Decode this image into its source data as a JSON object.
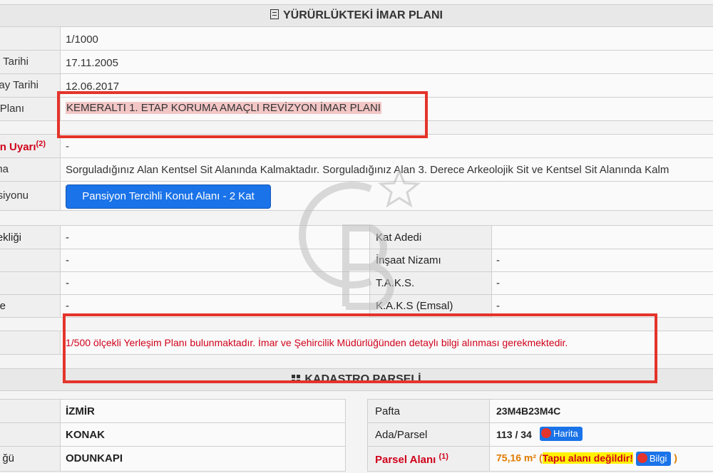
{
  "section_imar": {
    "title": "YÜRÜRLÜKTEKİ İMAR PLANI",
    "icon": "document-icon"
  },
  "rows": [
    {
      "label": "",
      "value": "1/1000"
    },
    {
      "label": "Tarihi",
      "value": "17.11.2005"
    },
    {
      "label": "ay Tarihi",
      "value": "12.06.2017"
    },
    {
      "label": "Planı",
      "value": "KEMERALTI 1. ETAP KORUMA AMAÇLI REVİZYON İMAR PLANI"
    },
    {
      "label": "n Uyarı",
      "label_sup": "(2)",
      "value": "-"
    },
    {
      "label": "ma",
      "value": "Sorguladığınız Alan Kentsel Sit Alanında Kalmaktadır. Sorguladığınız Alan 3. Derece Arkeolojik Sit ve Kentsel Sit Alanında Kalm"
    },
    {
      "label": "siyonu",
      "button": "Pansiyon Tercihli Konut Alanı - 2 Kat"
    }
  ],
  "detail_grid": [
    {
      "left_label": "ekliği",
      "left_value": "-",
      "right_label": "Kat Adedi",
      "right_value": ""
    },
    {
      "left_label": "",
      "left_value": "-",
      "right_label": "İnşaat Nizamı",
      "right_value": "-"
    },
    {
      "left_label": "",
      "left_value": "-",
      "right_label": "T.A.K.S.",
      "right_value": "-"
    },
    {
      "left_label": "e",
      "left_value": "-",
      "right_label": "K.A.K.S (Emsal)",
      "right_value": "-"
    }
  ],
  "warning_text": "1/500 ölçekli Yerleşim Planı bulunmaktadır. İmar ve Şehircilik Müdürlüğünden detaylı bilgi alınması gerekmektedir.",
  "section_kadastro": {
    "title": "KADASTRO PARSELİ",
    "icon": "grid-icon"
  },
  "kadastro_left": [
    {
      "label": "",
      "value": "İZMİR"
    },
    {
      "label": "",
      "value": "KONAK"
    },
    {
      "label": "ğü",
      "value": "ODUNKAPI"
    }
  ],
  "kadastro_right": [
    {
      "label": "Pafta",
      "value": "23M4B23M4C"
    },
    {
      "label": "Ada/Parsel",
      "value": "113 / 34",
      "button": "Harita"
    },
    {
      "label": "Parsel Alanı",
      "label_sup": "(1)",
      "value": "75,16 m²",
      "note_open": "(",
      "note": "Tapu alanı değildir!",
      "button": "Bilgi",
      "note_close": ")"
    }
  ],
  "colors": {
    "accent": "#1a73e8",
    "alert": "#e4342b",
    "warning_text": "#d0021b",
    "highlight": "#f3c6c6",
    "yellow": "#fff200"
  }
}
